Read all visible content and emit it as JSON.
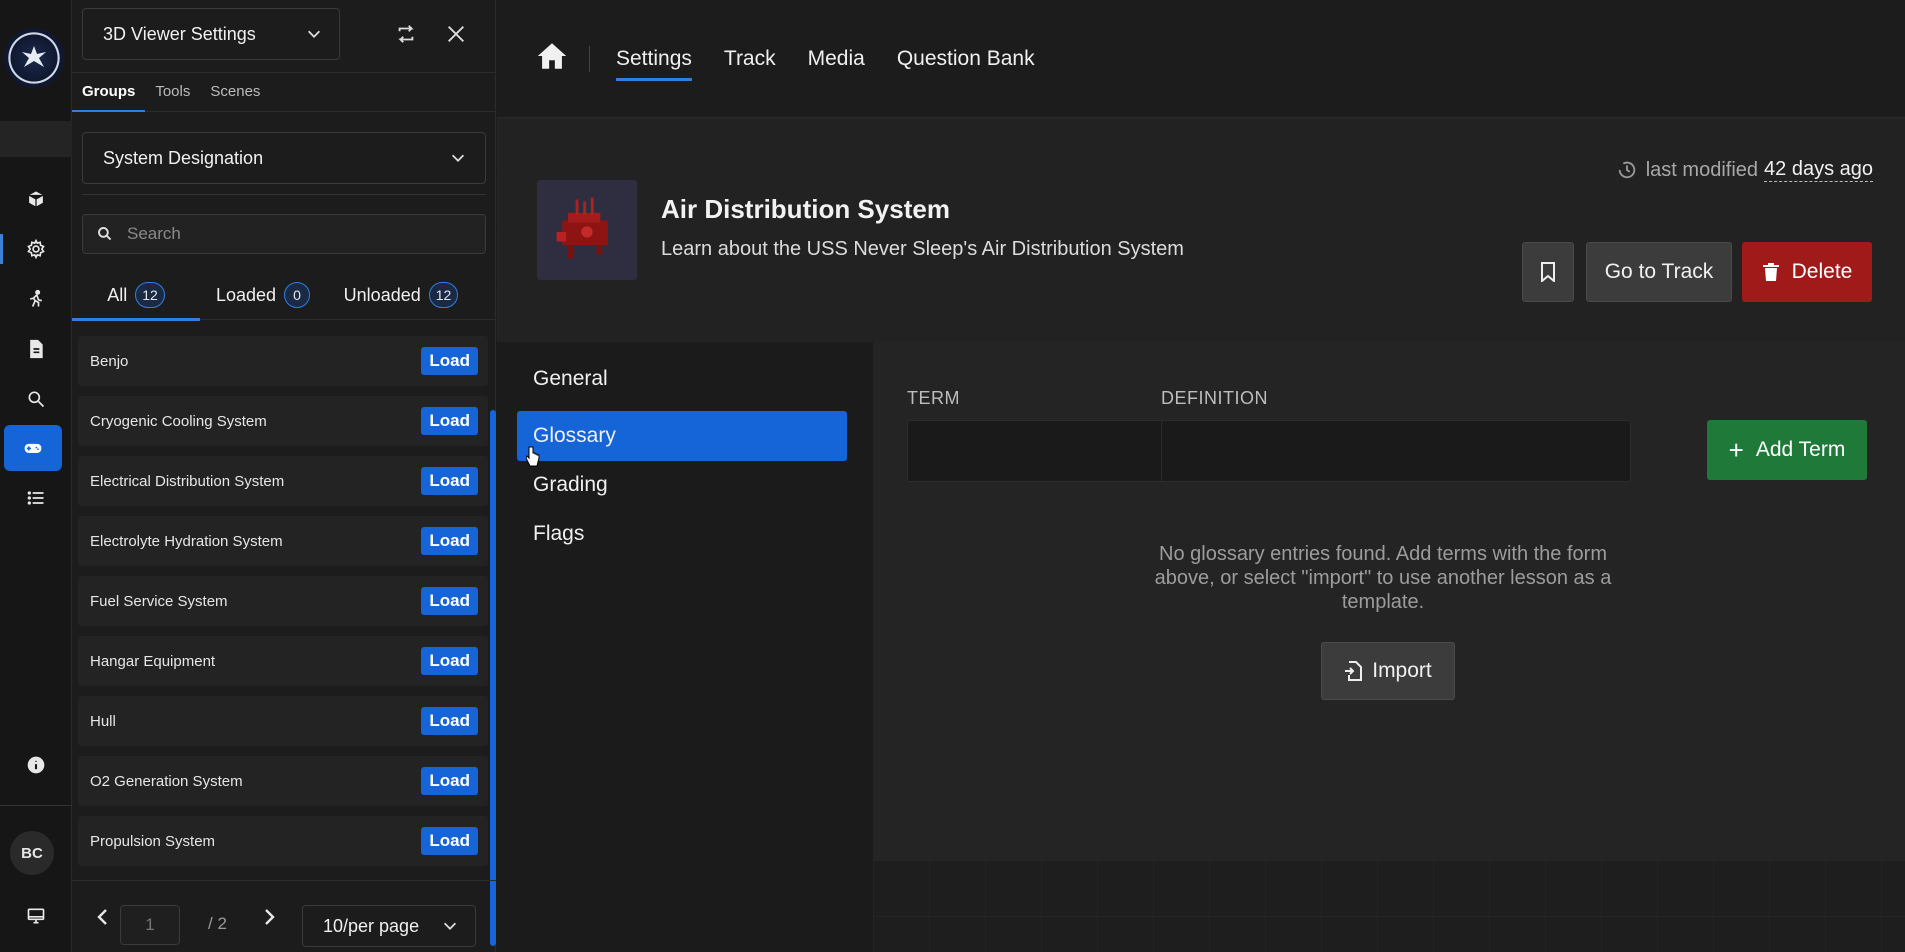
{
  "rail": {
    "avatar_initials": "BC",
    "icons": [
      "cube-icon",
      "gear-icon",
      "walking-person-icon",
      "document-icon",
      "search-icon",
      "gamepad-icon",
      "list-icon",
      "info-icon",
      "monitor-icon"
    ]
  },
  "panel": {
    "title": "3D Viewer Settings",
    "tabs": [
      "Groups",
      "Tools",
      "Scenes"
    ],
    "designation": "System Designation",
    "search_placeholder": "Search",
    "filters": [
      {
        "label": "All",
        "count": "12"
      },
      {
        "label": "Loaded",
        "count": "0"
      },
      {
        "label": "Unloaded",
        "count": "12"
      }
    ],
    "load_label": "Load",
    "items": [
      "Benjo",
      "Cryogenic Cooling System",
      "Electrical Distribution System",
      "Electrolyte Hydration System",
      "Fuel Service System",
      "Hangar Equipment",
      "Hull",
      "O2 Generation System",
      "Propulsion System"
    ],
    "pager": {
      "page_placeholder": "1",
      "total": "/ 2",
      "per_page": "10/per page"
    }
  },
  "topnav": {
    "links": [
      "Settings",
      "Track",
      "Media",
      "Question Bank"
    ],
    "active": "Settings"
  },
  "lesson": {
    "title": "Air Distribution System",
    "subtitle": "Learn about the USS Never Sleep's Air Distribution System",
    "modified_prefix": "last modified",
    "modified_ago": "42 days ago",
    "go_to_track": "Go to Track",
    "delete": "Delete"
  },
  "sidemenu": {
    "items": [
      "General",
      "Glossary",
      "Grading",
      "Flags"
    ],
    "active": "Glossary"
  },
  "glossary": {
    "term_label": "TERM",
    "definition_label": "DEFINITION",
    "add_term": "Add Term",
    "empty_message": "No glossary entries found. Add terms with the form above, or select \"import\" to use another lesson as a template.",
    "import": "Import"
  },
  "colors": {
    "accent": "#1565d8",
    "danger": "#a11a1a",
    "success": "#1f7a3a"
  }
}
